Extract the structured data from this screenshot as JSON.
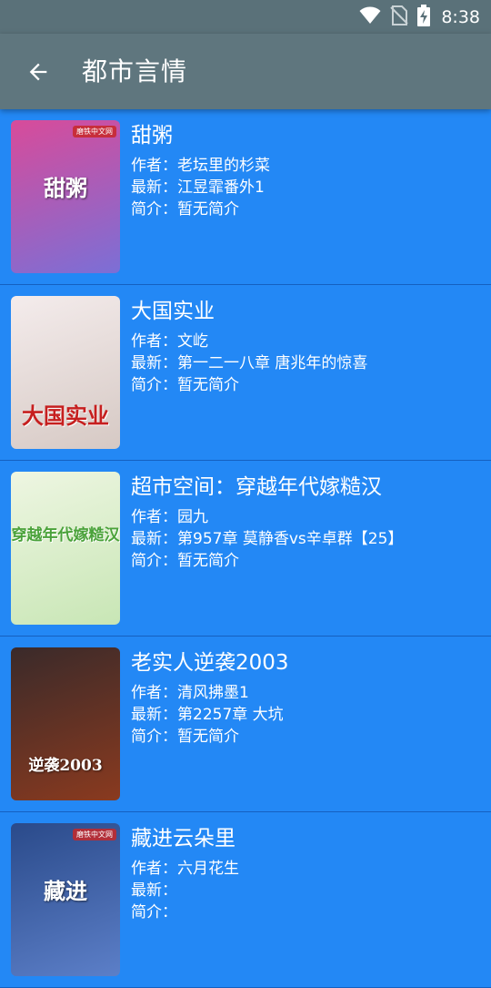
{
  "status": {
    "time": "8:38",
    "icons": [
      "wifi-icon",
      "no-sim-icon",
      "battery-charging-icon"
    ]
  },
  "appbar": {
    "title": "都市言情",
    "back_icon": "arrow-left-icon"
  },
  "labels": {
    "author": "作者：",
    "latest": "最新：",
    "intro": "简介："
  },
  "books": [
    {
      "title": "甜粥",
      "author": "老坛里的杉菜",
      "latest": "江昱霏番外1",
      "intro": "暂无简介",
      "cover": {
        "text": "甜粥",
        "badge": "磨铁中文网",
        "colors": [
          "#d84b9a",
          "#7b6fd6"
        ]
      }
    },
    {
      "title": "大国实业",
      "author": "文屹",
      "latest": "第一二一八章 唐兆年的惊喜",
      "intro": "暂无简介",
      "cover": {
        "text": "大国实业",
        "badge": "",
        "colors": [
          "#f4ecec",
          "#d6c9c4"
        ]
      }
    },
    {
      "title": "超市空间：穿越年代嫁糙汉",
      "author": "园九",
      "latest": "第957章 莫静香vs辛卓群【25】",
      "intro": "暂无简介",
      "cover": {
        "text": "穿越年代嫁糙汉",
        "badge": "",
        "colors": [
          "#eef6e2",
          "#c8e6b5"
        ]
      }
    },
    {
      "title": "老实人逆袭2003",
      "author": "清风拂墨1",
      "latest": "第2257章 大坑",
      "intro": "暂无简介",
      "cover": {
        "text": "逆袭2003",
        "badge": "",
        "colors": [
          "#3a2a2a",
          "#8a3a1f"
        ]
      }
    },
    {
      "title": "藏进云朵里",
      "author": "六月花生",
      "latest": "",
      "intro": "",
      "cover": {
        "text": "藏进",
        "badge": "磨铁中文网",
        "colors": [
          "#2a4a8a",
          "#5c7fc8"
        ]
      }
    }
  ]
}
